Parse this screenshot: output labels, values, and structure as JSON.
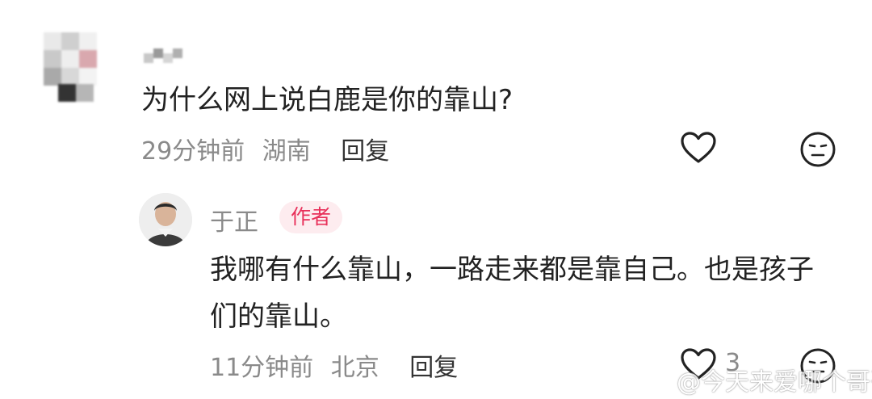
{
  "comment": {
    "text": "为什么网上说白鹿是你的靠山?",
    "time": "29分钟前",
    "location": "湖南",
    "reply_label": "回复"
  },
  "reply": {
    "author": "于正",
    "badge": "作者",
    "text": "我哪有什么靠山，一路走来都是靠自己。也是孩子们的靠山。",
    "time": "11分钟前",
    "location": "北京",
    "reply_label": "回复",
    "like_count": "3"
  },
  "watermark": {
    "text": "@今天来爱哪个哥哥"
  },
  "colors": {
    "meta_gray": "#8a8a8a",
    "badge_text": "#e8305a",
    "badge_bg": "#fdecef"
  },
  "icons": [
    "heart-icon",
    "expressionless-face-icon",
    "weibo-logo-icon"
  ]
}
